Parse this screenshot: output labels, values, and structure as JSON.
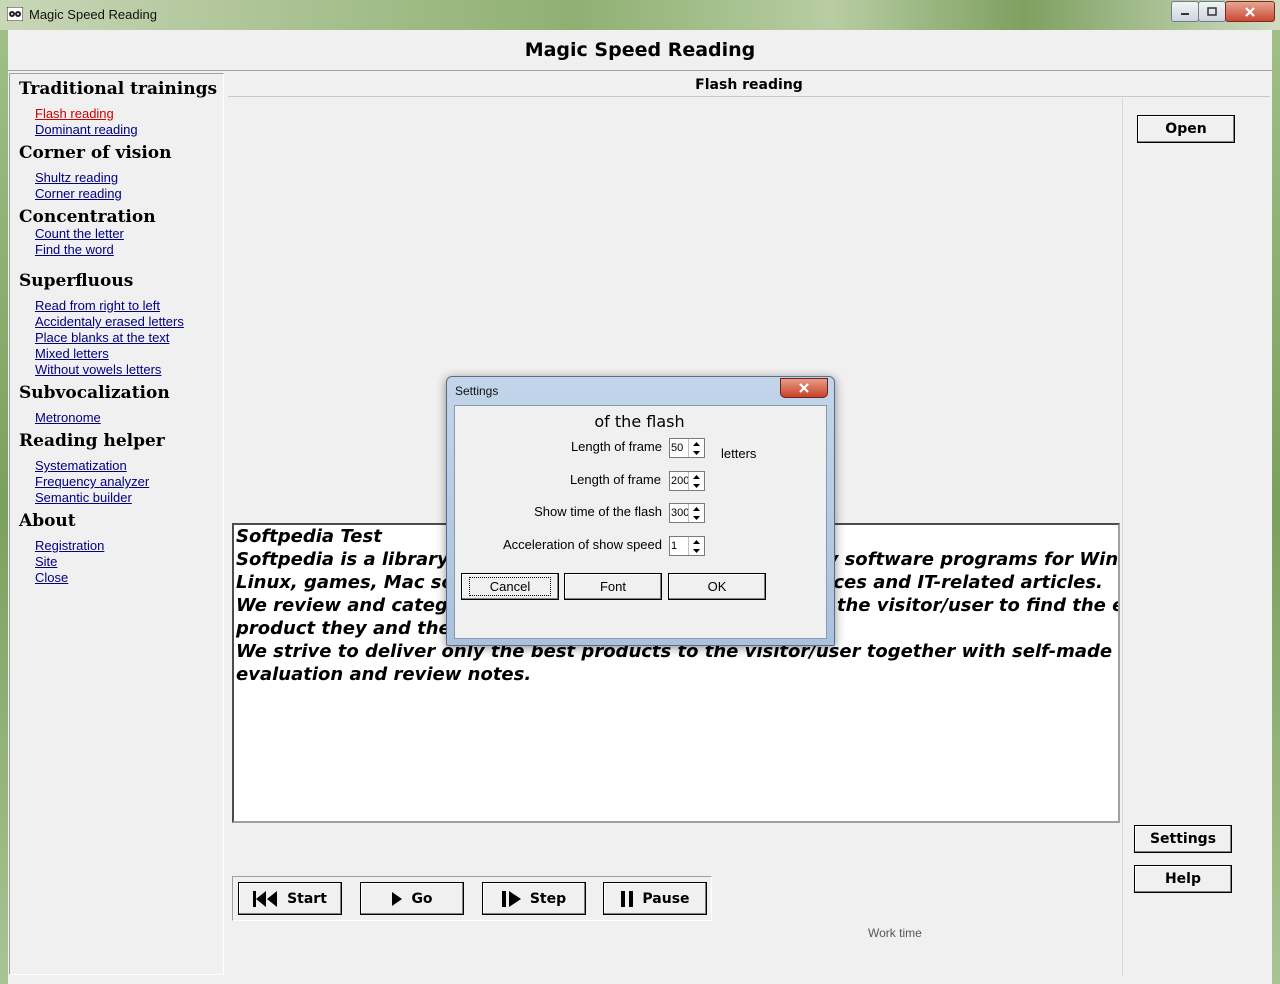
{
  "window": {
    "title": "Magic Speed Reading"
  },
  "app": {
    "title": "Magic Speed Reading",
    "mode_title": "Flash reading"
  },
  "sidebar": {
    "sections": [
      {
        "title": "Traditional trainings",
        "items": [
          {
            "label": "Flash reading",
            "active": true
          },
          {
            "label": "Dominant reading"
          }
        ]
      },
      {
        "title": "Corner of vision",
        "items": [
          {
            "label": "Shultz reading"
          },
          {
            "label": "Corner reading"
          }
        ]
      },
      {
        "title": "Concentration",
        "items": [
          {
            "label": "Count the letter"
          },
          {
            "label": "Find the word"
          }
        ]
      },
      {
        "title": "Superfluous",
        "items": [
          {
            "label": "Read from right to left"
          },
          {
            "label": "Accidentaly erased letters"
          },
          {
            "label": "Place blanks at the text"
          },
          {
            "label": "Mixed letters"
          },
          {
            "label": "Without vowels letters"
          }
        ]
      },
      {
        "title": "Subvocalization",
        "items": [
          {
            "label": "Metronome"
          }
        ]
      },
      {
        "title": "Reading helper",
        "items": [
          {
            "label": "Systematization"
          },
          {
            "label": "Frequency analyzer"
          },
          {
            "label": "Semantic builder"
          }
        ]
      },
      {
        "title": "About",
        "items": [
          {
            "label": "Registration"
          },
          {
            "label": "Site"
          },
          {
            "label": "Close"
          }
        ]
      }
    ]
  },
  "right_buttons": {
    "open": "Open",
    "settings": "Settings",
    "help": "Help"
  },
  "text_lines": [
    "Softpedia Test",
    "Softpedia is a library of over 1,000,000 free and free-to-try software programs for Windows and",
    "Linux, games, Mac software, Windows drivers, mobile devices and IT-related articles.",
    "We review and categorize these products in order to allow the visitor/user to find the exact",
    "product they and their system needs.",
    "We strive to deliver only the best products to the visitor/user together with self-made",
    "evaluation and review notes."
  ],
  "controls": {
    "start": "Start",
    "go": "Go",
    "step": "Step",
    "pause": "Pause"
  },
  "work_time_label": "Work time",
  "dialog": {
    "title": "Settings",
    "heading": "of the flash",
    "rows": [
      {
        "label": "Length of frame",
        "value": "50",
        "unit": "letters"
      },
      {
        "label": "Length of frame",
        "value": "200",
        "unit": ""
      },
      {
        "label": "Show time of the flash",
        "value": "300",
        "unit": ""
      },
      {
        "label": "Acceleration of show speed",
        "value": "1",
        "unit": ""
      }
    ],
    "buttons": {
      "cancel": "Cancel",
      "font": "Font",
      "ok": "OK"
    }
  }
}
